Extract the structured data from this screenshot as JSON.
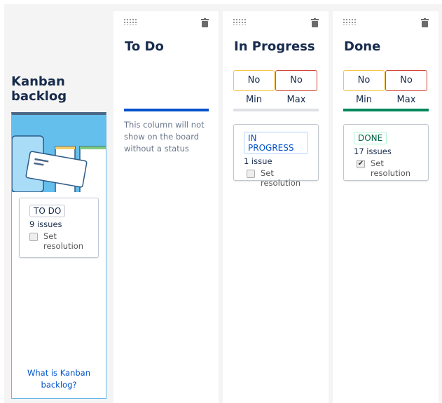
{
  "backlog": {
    "title": "Kanban backlog",
    "card": {
      "status": "TO DO",
      "count": "9 issues",
      "resolution_label": "Set resolution",
      "resolution_checked": false
    },
    "help_link": "What is Kanban backlog?"
  },
  "columns": [
    {
      "title": "To Do",
      "bar_color": "#0052cc",
      "note": "This column will not show on the board without a status"
    },
    {
      "title": "In Progress",
      "bar_color": "#dfe1e6",
      "min_label": "No Min",
      "max_label": "No Max",
      "card": {
        "status": "IN PROGRESS",
        "count": "1 issue",
        "resolution_label": "Set resolution",
        "resolution_checked": false
      }
    },
    {
      "title": "Done",
      "bar_color": "#00875a",
      "min_label": "No Min",
      "max_label": "No Max",
      "card": {
        "status": "DONE",
        "count": "17 issues",
        "resolution_label": "Set resolution",
        "resolution_checked": true
      }
    }
  ]
}
